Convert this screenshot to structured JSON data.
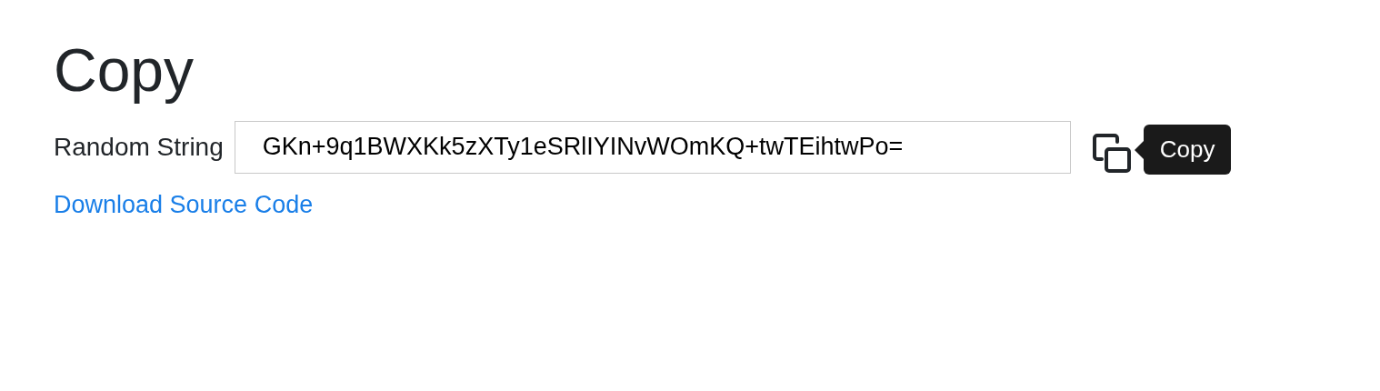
{
  "heading": "Copy",
  "field": {
    "label": "Random String",
    "value": "GKn+9q1BWXKk5zXTy1eSRlIYINvWOmKQ+twTEihtwPo="
  },
  "tooltip": {
    "text": "Copy"
  },
  "link": "Download Source Code"
}
